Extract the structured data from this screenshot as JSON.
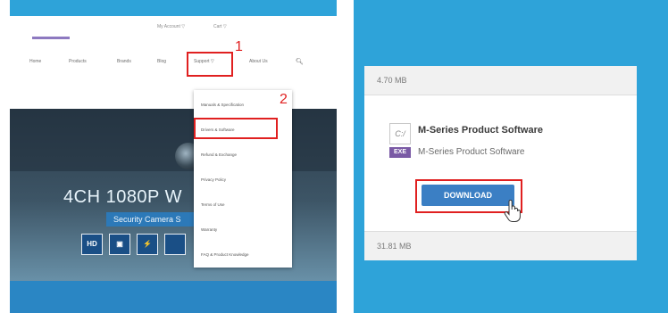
{
  "left_panel": {
    "top_links": {
      "account": "My Account ▽",
      "cart": "Cart ▽"
    },
    "nav": {
      "items": [
        "Home",
        "Products",
        "Brands",
        "Blog",
        "Support ▽",
        "About Us"
      ],
      "search_icon": "search-icon"
    },
    "step1": "1",
    "step2": "2",
    "dropdown": [
      "Manuals & Specification",
      "Drivers & Software",
      "Refund & Exchange",
      "Privacy Policy",
      "Terms of Use",
      "Warranty",
      "FAQ & Product Knowledge"
    ],
    "hero": {
      "title": "4CH 1080P W",
      "subtitle": "Security Camera S",
      "features": [
        "HD",
        "▣",
        "⚡",
        ""
      ]
    }
  },
  "right_panel": {
    "size_top": "4.70 MB",
    "file_icon_text": "C:/",
    "badge": "EXE",
    "product_title": "M-Series Product Software",
    "product_sub": "M-Series Product Software",
    "download_label": "DOWNLOAD",
    "size_bottom": "31.81 MB",
    "colors": {
      "background": "#2ea3d9",
      "button": "#3b7fc4",
      "highlight": "#e02020"
    }
  }
}
